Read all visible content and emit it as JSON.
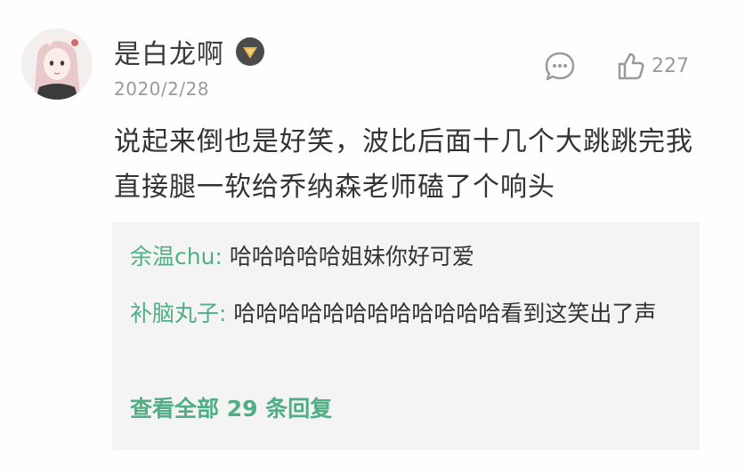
{
  "comment": {
    "username": "是白龙啊",
    "date": "2020/2/28",
    "like_count": "227",
    "text": "说起来倒也是好笑，波比后面十几个大跳跳完我直接腿一软给乔纳森老师磕了个响头"
  },
  "replies": [
    {
      "author": "余温chu",
      "sep": ": ",
      "text": "哈哈哈哈哈姐妹你好可爱"
    },
    {
      "author": "补脑丸子",
      "sep": ": ",
      "text": "哈哈哈哈哈哈哈哈哈哈哈哈看到这笑出了声"
    }
  ],
  "view_all": "查看全部 29 条回复",
  "colors": {
    "accent_green": "#4fae85",
    "text_main": "#333333",
    "text_muted": "#9a9a9a",
    "reply_bg": "#f4f4f4"
  },
  "icons": {
    "badge": "level-badge-icon",
    "reply": "comment-bubble-icon",
    "like": "thumb-up-icon"
  }
}
